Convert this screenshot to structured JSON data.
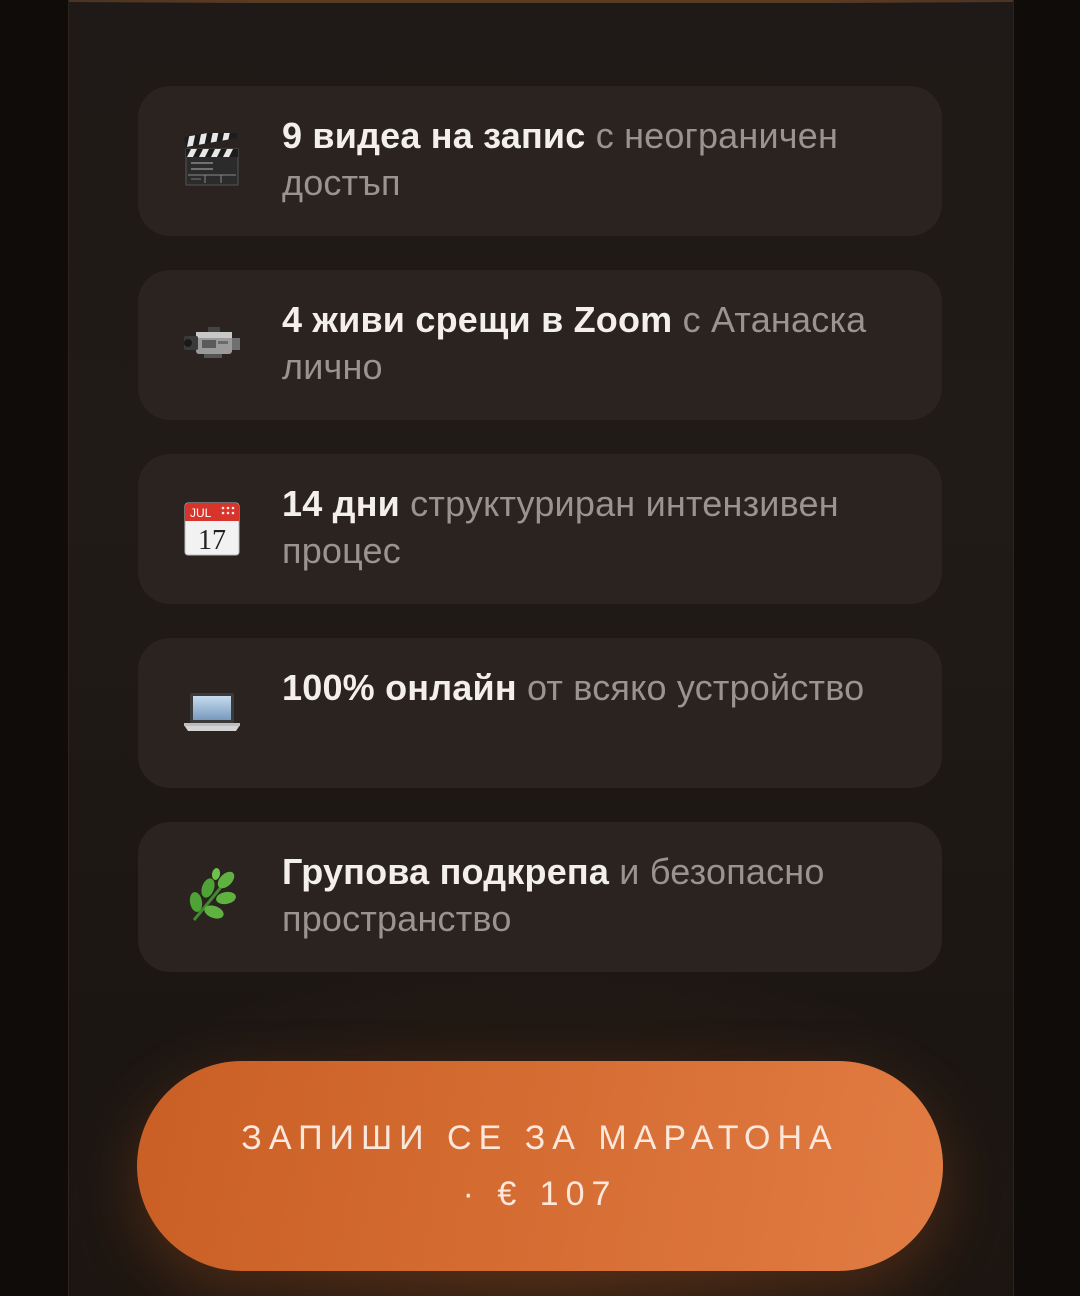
{
  "features": [
    {
      "icon": "clapperboard-icon",
      "bold": "9 видеа на запис",
      "rest": " с неограничен достъп"
    },
    {
      "icon": "video-camera-icon",
      "bold": "4 живи срещи в Zoom",
      "rest": " с Атанаска лично"
    },
    {
      "icon": "calendar-icon",
      "bold": "14 дни",
      "rest": " структуриран интензивен процес",
      "calendar_month": "JUL",
      "calendar_day": "17"
    },
    {
      "icon": "laptop-icon",
      "bold": "100% онлайн",
      "rest": " от всяко устройство"
    },
    {
      "icon": "herb-icon",
      "bold": "Групова подкрепа",
      "rest": " и безопасно пространство"
    }
  ],
  "cta": {
    "line1": "ЗАПИШИ СЕ ЗА МАРАТОНА",
    "line2": "· € 107"
  },
  "colors": {
    "accent": "#d36a30",
    "card_bg": "#2a2320",
    "text_bold": "#f3efec",
    "text_muted": "#9b9390"
  }
}
